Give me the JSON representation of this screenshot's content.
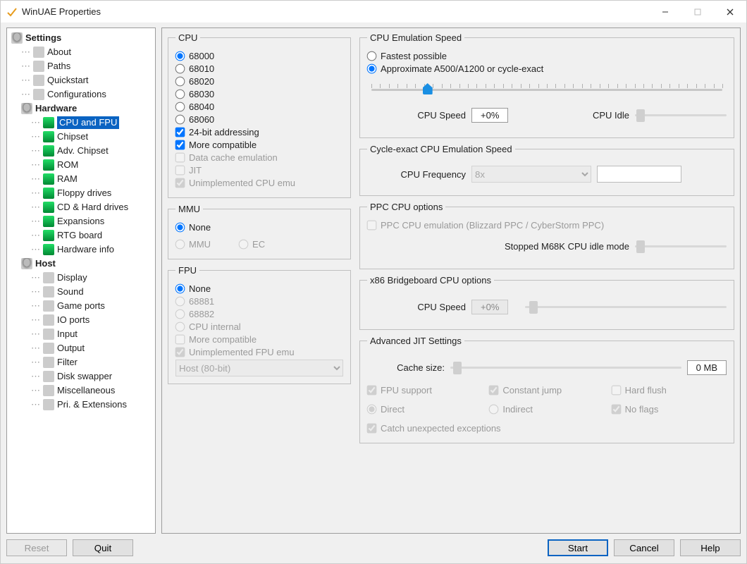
{
  "window": {
    "title": "WinUAE Properties"
  },
  "tree": {
    "root": "Settings",
    "items": [
      "About",
      "Paths",
      "Quickstart",
      "Configurations"
    ],
    "hardware": {
      "header": "Hardware",
      "items": [
        "CPU and FPU",
        "Chipset",
        "Adv. Chipset",
        "ROM",
        "RAM",
        "Floppy drives",
        "CD & Hard drives",
        "Expansions",
        "RTG board",
        "Hardware info"
      ],
      "selected": "CPU and FPU"
    },
    "host": {
      "header": "Host",
      "items": [
        "Display",
        "Sound",
        "Game ports",
        "IO ports",
        "Input",
        "Output",
        "Filter",
        "Disk swapper",
        "Miscellaneous",
        "Pri. & Extensions"
      ]
    }
  },
  "cpu_group": {
    "legend": "CPU",
    "options": [
      "68000",
      "68010",
      "68020",
      "68030",
      "68040",
      "68060"
    ],
    "selected": "68000",
    "addressing24": {
      "label": "24-bit addressing",
      "checked": true
    },
    "more_compat": {
      "label": "More compatible",
      "checked": true
    },
    "data_cache": {
      "label": "Data cache emulation",
      "checked": false
    },
    "jit": {
      "label": "JIT",
      "checked": false
    },
    "unimpl": {
      "label": "Unimplemented CPU emu",
      "checked": true
    }
  },
  "mmu_group": {
    "legend": "MMU",
    "none": "None",
    "mmu": "MMU",
    "ec": "EC",
    "selected": "None"
  },
  "fpu_group": {
    "legend": "FPU",
    "options": [
      "None",
      "68881",
      "68882",
      "CPU internal"
    ],
    "selected": "None",
    "more_compat": {
      "label": "More compatible",
      "checked": false
    },
    "unimpl": {
      "label": "Unimplemented FPU emu",
      "checked": true
    },
    "mode_select": {
      "value": "Host (80-bit)"
    }
  },
  "emuspeed": {
    "legend": "CPU Emulation Speed",
    "fastest": "Fastest possible",
    "approx": "Approximate A500/A1200 or cycle-exact",
    "selected": "approx",
    "cpu_speed_label": "CPU Speed",
    "cpu_speed_value": "+0%",
    "cpu_idle_label": "CPU Idle",
    "main_slider_pos_pct": 16
  },
  "cycle_exact": {
    "legend": "Cycle-exact CPU Emulation Speed",
    "freq_label": "CPU Frequency",
    "freq_value": "8x",
    "freq_extra": ""
  },
  "ppc": {
    "legend": "PPC CPU options",
    "emulation_label": "PPC CPU emulation (Blizzard PPC / CyberStorm PPC)",
    "idle_label": "Stopped M68K CPU idle mode"
  },
  "x86": {
    "legend": "x86 Bridgeboard CPU options",
    "cpu_speed_label": "CPU Speed",
    "cpu_speed_value": "+0%"
  },
  "jit": {
    "legend": "Advanced JIT Settings",
    "cache_label": "Cache size:",
    "cache_value": "0 MB",
    "fpu_support": "FPU support",
    "const_jump": "Constant jump",
    "hard_flush": "Hard flush",
    "direct": "Direct",
    "indirect": "Indirect",
    "no_flags": "No flags",
    "catch": "Catch unexpected exceptions"
  },
  "buttons": {
    "reset": "Reset",
    "quit": "Quit",
    "start": "Start",
    "cancel": "Cancel",
    "help": "Help"
  }
}
